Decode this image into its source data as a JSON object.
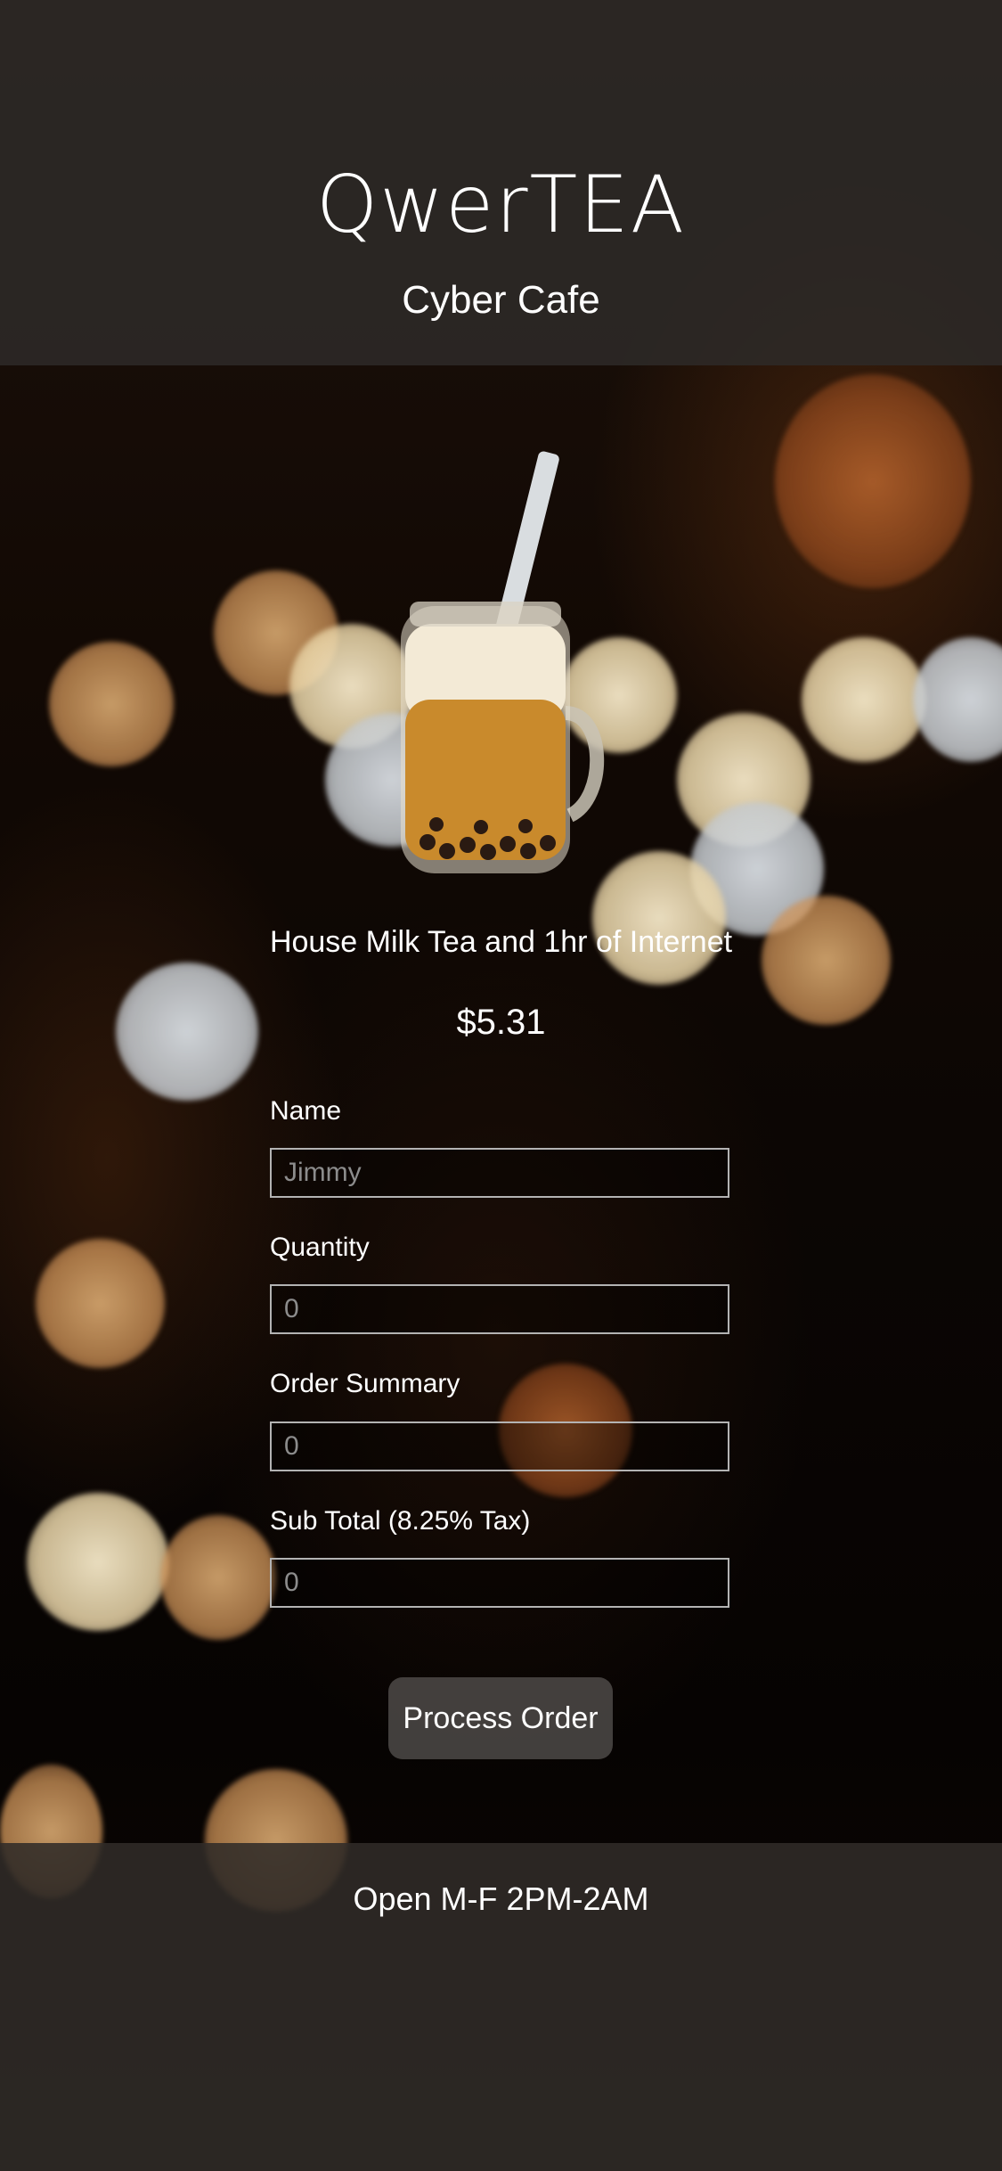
{
  "header": {
    "brand": "QwerTEA",
    "subtitle": "Cyber Cafe"
  },
  "product": {
    "image_icon": "milk-tea-jar-icon",
    "name": "House Milk Tea and 1hr of Internet",
    "price": "$5.31"
  },
  "form": {
    "name": {
      "label": "Name",
      "placeholder": "Jimmy"
    },
    "quantity": {
      "label": "Quantity",
      "placeholder": "0"
    },
    "order_summary": {
      "label": "Order Summary",
      "placeholder": "0"
    },
    "sub_total": {
      "label": "Sub Total (8.25% Tax)",
      "placeholder": "0"
    },
    "submit_label": "Process Order"
  },
  "footer": {
    "hours": "Open M-F 2PM-2AM"
  },
  "colors": {
    "header_bg": "#2d2a28",
    "footer_bg": "#302b28",
    "button_bg": "#4b4846",
    "input_border": "#b3b3b3",
    "tea": "#c98a2c",
    "foam": "#f3ead6"
  }
}
